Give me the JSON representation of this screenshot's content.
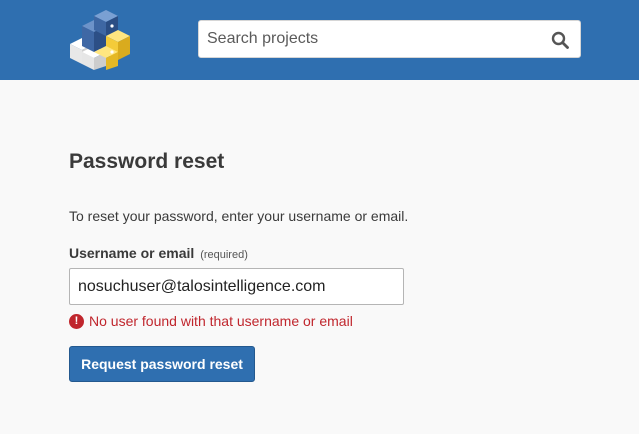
{
  "header": {
    "logo_icon": "pypi-logo-icon",
    "background": "#2f6fb0",
    "search": {
      "placeholder": "Search projects",
      "value": "",
      "icon": "search-icon"
    }
  },
  "main": {
    "title": "Password reset",
    "intro": "To reset your password, enter your username or email.",
    "field": {
      "label": "Username or email",
      "required": "(required)",
      "value": "nosuchuser@talosintelligence.com"
    },
    "error": {
      "icon": "error-icon",
      "glyph": "!",
      "message": "No user found with that username or email",
      "color": "#c0262d"
    },
    "submit_label": "Request password reset"
  }
}
